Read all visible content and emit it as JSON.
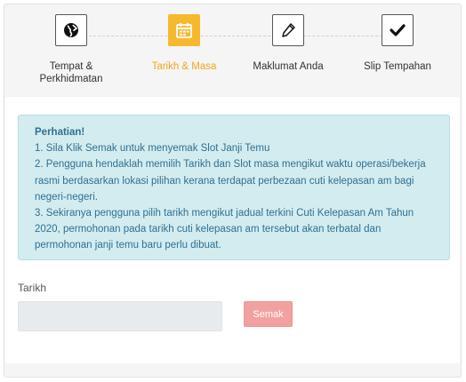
{
  "steps": [
    {
      "label_line1": "Tempat &",
      "label_line2": "Perkhidmatan",
      "icon": "globe-icon",
      "active": false
    },
    {
      "label_line1": "Tarikh & Masa",
      "label_line2": "",
      "icon": "calendar-icon",
      "active": true
    },
    {
      "label_line1": "Maklumat Anda",
      "label_line2": "",
      "icon": "pencil-icon",
      "active": false
    },
    {
      "label_line1": "Slip Tempahan",
      "label_line2": "",
      "icon": "check-icon",
      "active": false
    }
  ],
  "notice": {
    "title": "Perhatian!",
    "line1": "1. Sila Klik Semak untuk menyemak Slot Janji Temu",
    "line2": "2. Pengguna hendaklah memilih Tarikh dan Slot masa mengikut waktu operasi/bekerja rasmi berdasarkan lokasi pilihan kerana terdapat perbezaan cuti kelepasan am bagi negeri-negeri.",
    "line3": "3. Sekiranya pengguna pilih tarikh mengikut jadual terkini Cuti Kelepasan Am Tahun 2020, permohonan pada tarikh cuti kelepasan am tersebut akan terbatal dan permohonan janji temu baru perlu dibuat."
  },
  "form": {
    "date_label": "Tarikh",
    "date_value": "",
    "check_button_label": "Semak"
  },
  "colors": {
    "active_step": "#f6b92e",
    "alert_background": "#d3ecf0",
    "alert_text": "#31708f",
    "button_background": "#f1a2a0"
  }
}
